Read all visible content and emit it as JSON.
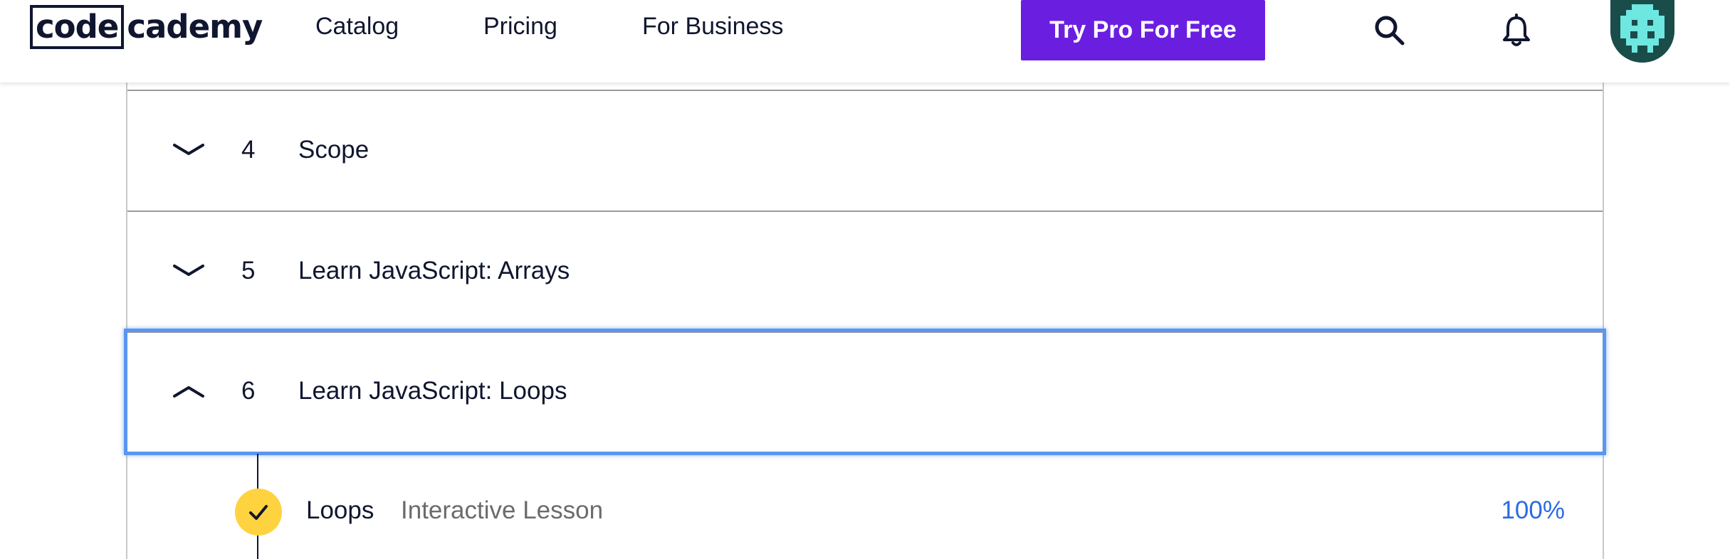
{
  "header": {
    "logo": {
      "boxed": "code",
      "rest": "cademy"
    },
    "nav": [
      {
        "label": "Catalog"
      },
      {
        "label": "Pricing"
      },
      {
        "label": "For Business"
      }
    ],
    "cta_label": "Try Pro For Free",
    "icons": {
      "search": "search-icon",
      "notifications": "bell-icon",
      "avatar": "pixel-avatar"
    },
    "colors": {
      "cta": "#6a1fe0",
      "avatar_bg": "#1a4d4a",
      "avatar_fg": "#6ee7e0"
    }
  },
  "outline": {
    "modules": [
      {
        "number": "4",
        "title": "Scope",
        "expanded": false
      },
      {
        "number": "5",
        "title": "Learn JavaScript: Arrays",
        "expanded": false
      },
      {
        "number": "6",
        "title": "Learn JavaScript: Loops",
        "expanded": true
      }
    ],
    "lessons": [
      {
        "title": "Loops",
        "type": "Interactive Lesson",
        "progress": "100%",
        "completed": true
      }
    ],
    "colors": {
      "focus_border": "#5b95f0",
      "check_bg": "#ffd23f",
      "progress_text": "#2b6be4"
    }
  }
}
